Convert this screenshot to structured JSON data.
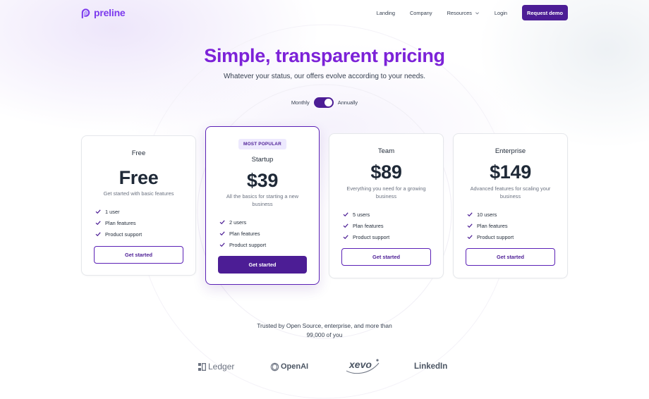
{
  "brand": {
    "name": "preline",
    "accent": "#7c3aed",
    "primary": "#4c1d95"
  },
  "nav": {
    "links": [
      "Landing",
      "Company",
      "Resources",
      "Login"
    ],
    "cta": "Request demo"
  },
  "hero": {
    "title": "Simple, transparent pricing",
    "subtitle": "Whatever your status, our offers evolve according to your needs."
  },
  "billing": {
    "monthly": "Monthly",
    "annually": "Annually",
    "selected": "Annually"
  },
  "plans": [
    {
      "name": "Free",
      "price": "Free",
      "description": "Get started with basic features",
      "features": [
        "1 user",
        "Plan features",
        "Product support"
      ],
      "cta": "Get started"
    },
    {
      "badge": "MOST POPULAR",
      "name": "Startup",
      "price": "$39",
      "description": "All the basics for starting a new business",
      "features": [
        "2 users",
        "Plan features",
        "Product support"
      ],
      "cta": "Get started"
    },
    {
      "name": "Team",
      "price": "$89",
      "description": "Everything you need for a growing business",
      "features": [
        "5 users",
        "Plan features",
        "Product support"
      ],
      "cta": "Get started"
    },
    {
      "name": "Enterprise",
      "price": "$149",
      "description": "Advanced features for scaling your business",
      "features": [
        "10 users",
        "Plan features",
        "Product support"
      ],
      "cta": "Get started"
    }
  ],
  "trusted": {
    "line1": "Trusted by Open Source, enterprise, and more than",
    "line2": "99,000 of you"
  },
  "partner_logos": [
    "Ledger",
    "OpenAI",
    "xevo",
    "LinkedIn"
  ]
}
